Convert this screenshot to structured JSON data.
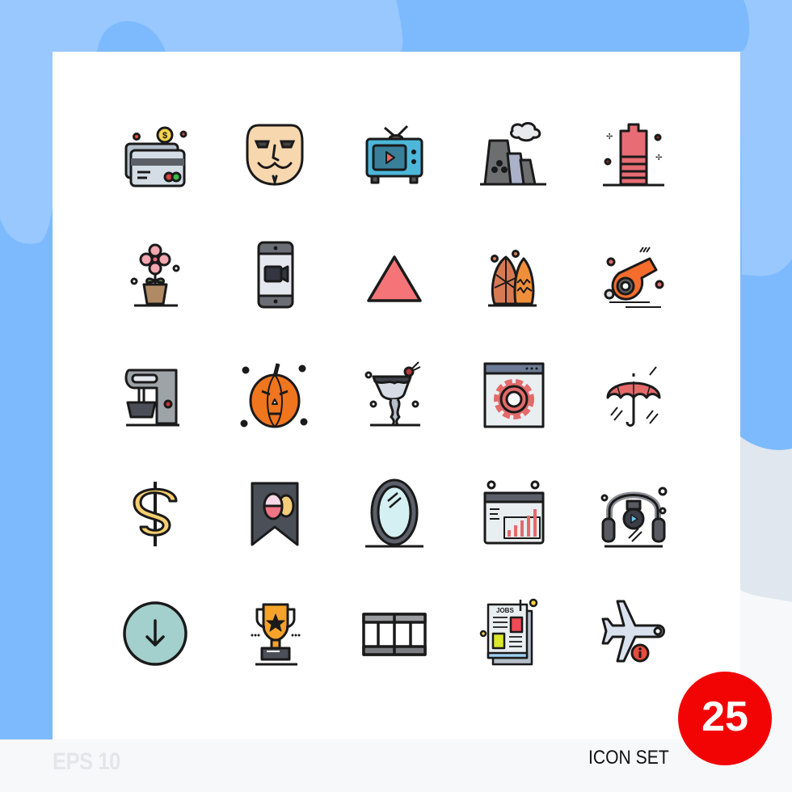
{
  "footer": {
    "format_label": "EPS 10",
    "set_label": "ICON SET",
    "count_badge": "25"
  },
  "colors": {
    "background_light_blue": "#98c8fd",
    "background_mid_blue": "#7dbafd",
    "background_gray": "#e1e7ee",
    "card": "#ffffff",
    "badge_red": "#f30404",
    "outline": "#1a1a1a"
  },
  "icons": [
    {
      "name": "credit-cards-dollar-icon"
    },
    {
      "name": "anonymous-mask-icon"
    },
    {
      "name": "retro-tv-play-icon"
    },
    {
      "name": "power-plant-factory-icon"
    },
    {
      "name": "low-battery-icon"
    },
    {
      "name": "potted-flower-icon"
    },
    {
      "name": "mobile-video-camera-icon"
    },
    {
      "name": "triangle-up-icon"
    },
    {
      "name": "surfboards-icon"
    },
    {
      "name": "whistle-icon"
    },
    {
      "name": "stand-mixer-icon"
    },
    {
      "name": "halloween-pumpkin-icon"
    },
    {
      "name": "halloween-cocktail-icon"
    },
    {
      "name": "browser-settings-gear-icon"
    },
    {
      "name": "umbrella-rain-icon"
    },
    {
      "name": "dollar-sign-icon"
    },
    {
      "name": "easter-eggs-bookmark-icon"
    },
    {
      "name": "oval-mirror-icon"
    },
    {
      "name": "web-analytics-chart-icon"
    },
    {
      "name": "headphones-music-icon"
    },
    {
      "name": "download-arrow-circle-icon"
    },
    {
      "name": "trophy-star-icon"
    },
    {
      "name": "film-strip-table-icon"
    },
    {
      "name": "jobs-newspaper-icon"
    },
    {
      "name": "airplane-info-icon"
    }
  ]
}
